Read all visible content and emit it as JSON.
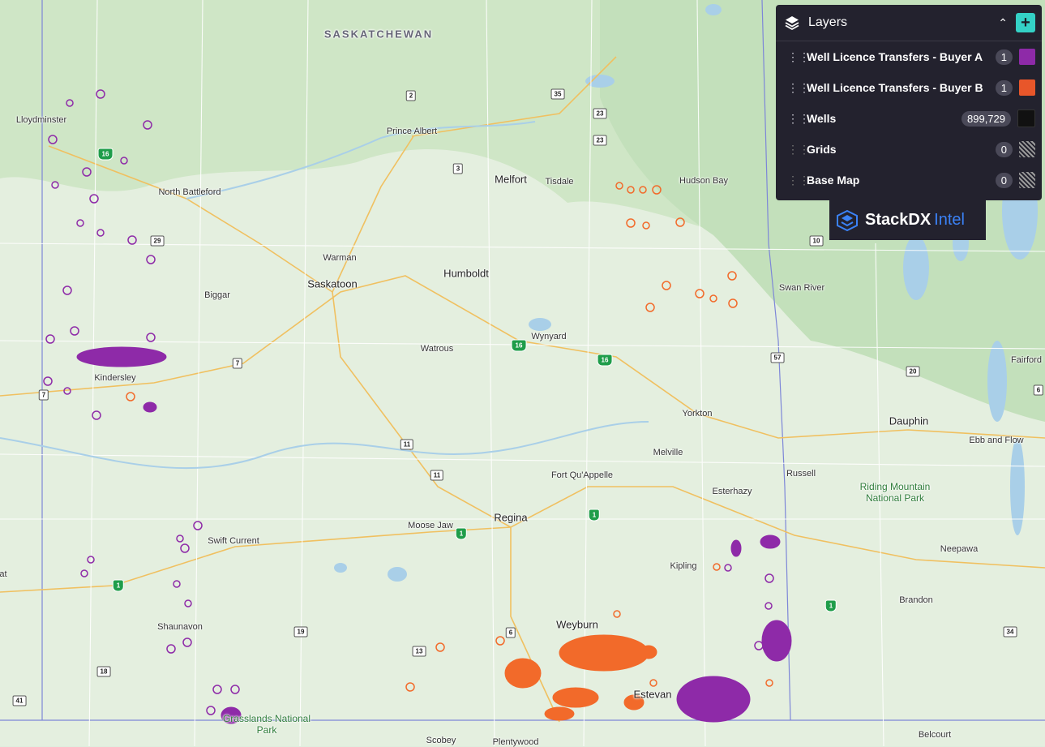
{
  "layers_panel": {
    "title": "Layers",
    "collapse_icon": "chevron-up-icon",
    "add_icon": "plus-icon",
    "items": [
      {
        "label": "Well Licence Transfers - Buyer A",
        "count": "1",
        "color": "#8e2aa8"
      },
      {
        "label": "Well Licence Transfers - Buyer B",
        "count": "1",
        "color": "#e8562a"
      },
      {
        "label": "Wells",
        "count": "899,729",
        "color": "#111111"
      },
      {
        "label": "Grids",
        "count": "0",
        "color": "hatched"
      },
      {
        "label": "Base Map",
        "count": "0",
        "color": "hatched"
      }
    ]
  },
  "brand": {
    "name": "StackDX",
    "suffix": "Intel",
    "icon": "stackdx-logo-icon"
  },
  "map": {
    "region_label": "SASKATCHEWAN",
    "places": [
      "Lloydminster",
      "Prince Albert",
      "Melfort",
      "Tisdale",
      "Hudson Bay",
      "North Battleford",
      "Warman",
      "Saskatoon",
      "Humboldt",
      "Biggar",
      "Swan River",
      "Wynyard",
      "Watrous",
      "Kindersley",
      "Fairford",
      "Dauphin",
      "Yorkton",
      "Melville",
      "Ebb and Flow",
      "Russell",
      "Fort Qu'Appelle",
      "Esterhazy",
      "Regina",
      "Moose Jaw",
      "Swift Current",
      "Neepawa",
      "Kipling",
      "Brandon",
      "Weyburn",
      "Shaunavon",
      "Estevan",
      "Scobey",
      "Plentywood",
      "Belcourt"
    ],
    "parks": [
      "Riding Mountain National Park",
      "Grasslands National Park"
    ],
    "route_shields": [
      "2",
      "35",
      "23",
      "23",
      "3",
      "16",
      "29",
      "10",
      "57",
      "20",
      "7",
      "7",
      "11",
      "11",
      "6",
      "13",
      "19",
      "18",
      "41",
      "34",
      "6"
    ],
    "highway_1_shields": [
      "1",
      "1",
      "1",
      "1"
    ],
    "highway_16_shields": [
      "16",
      "16",
      "16"
    ],
    "edge_labels": [
      "at"
    ]
  }
}
